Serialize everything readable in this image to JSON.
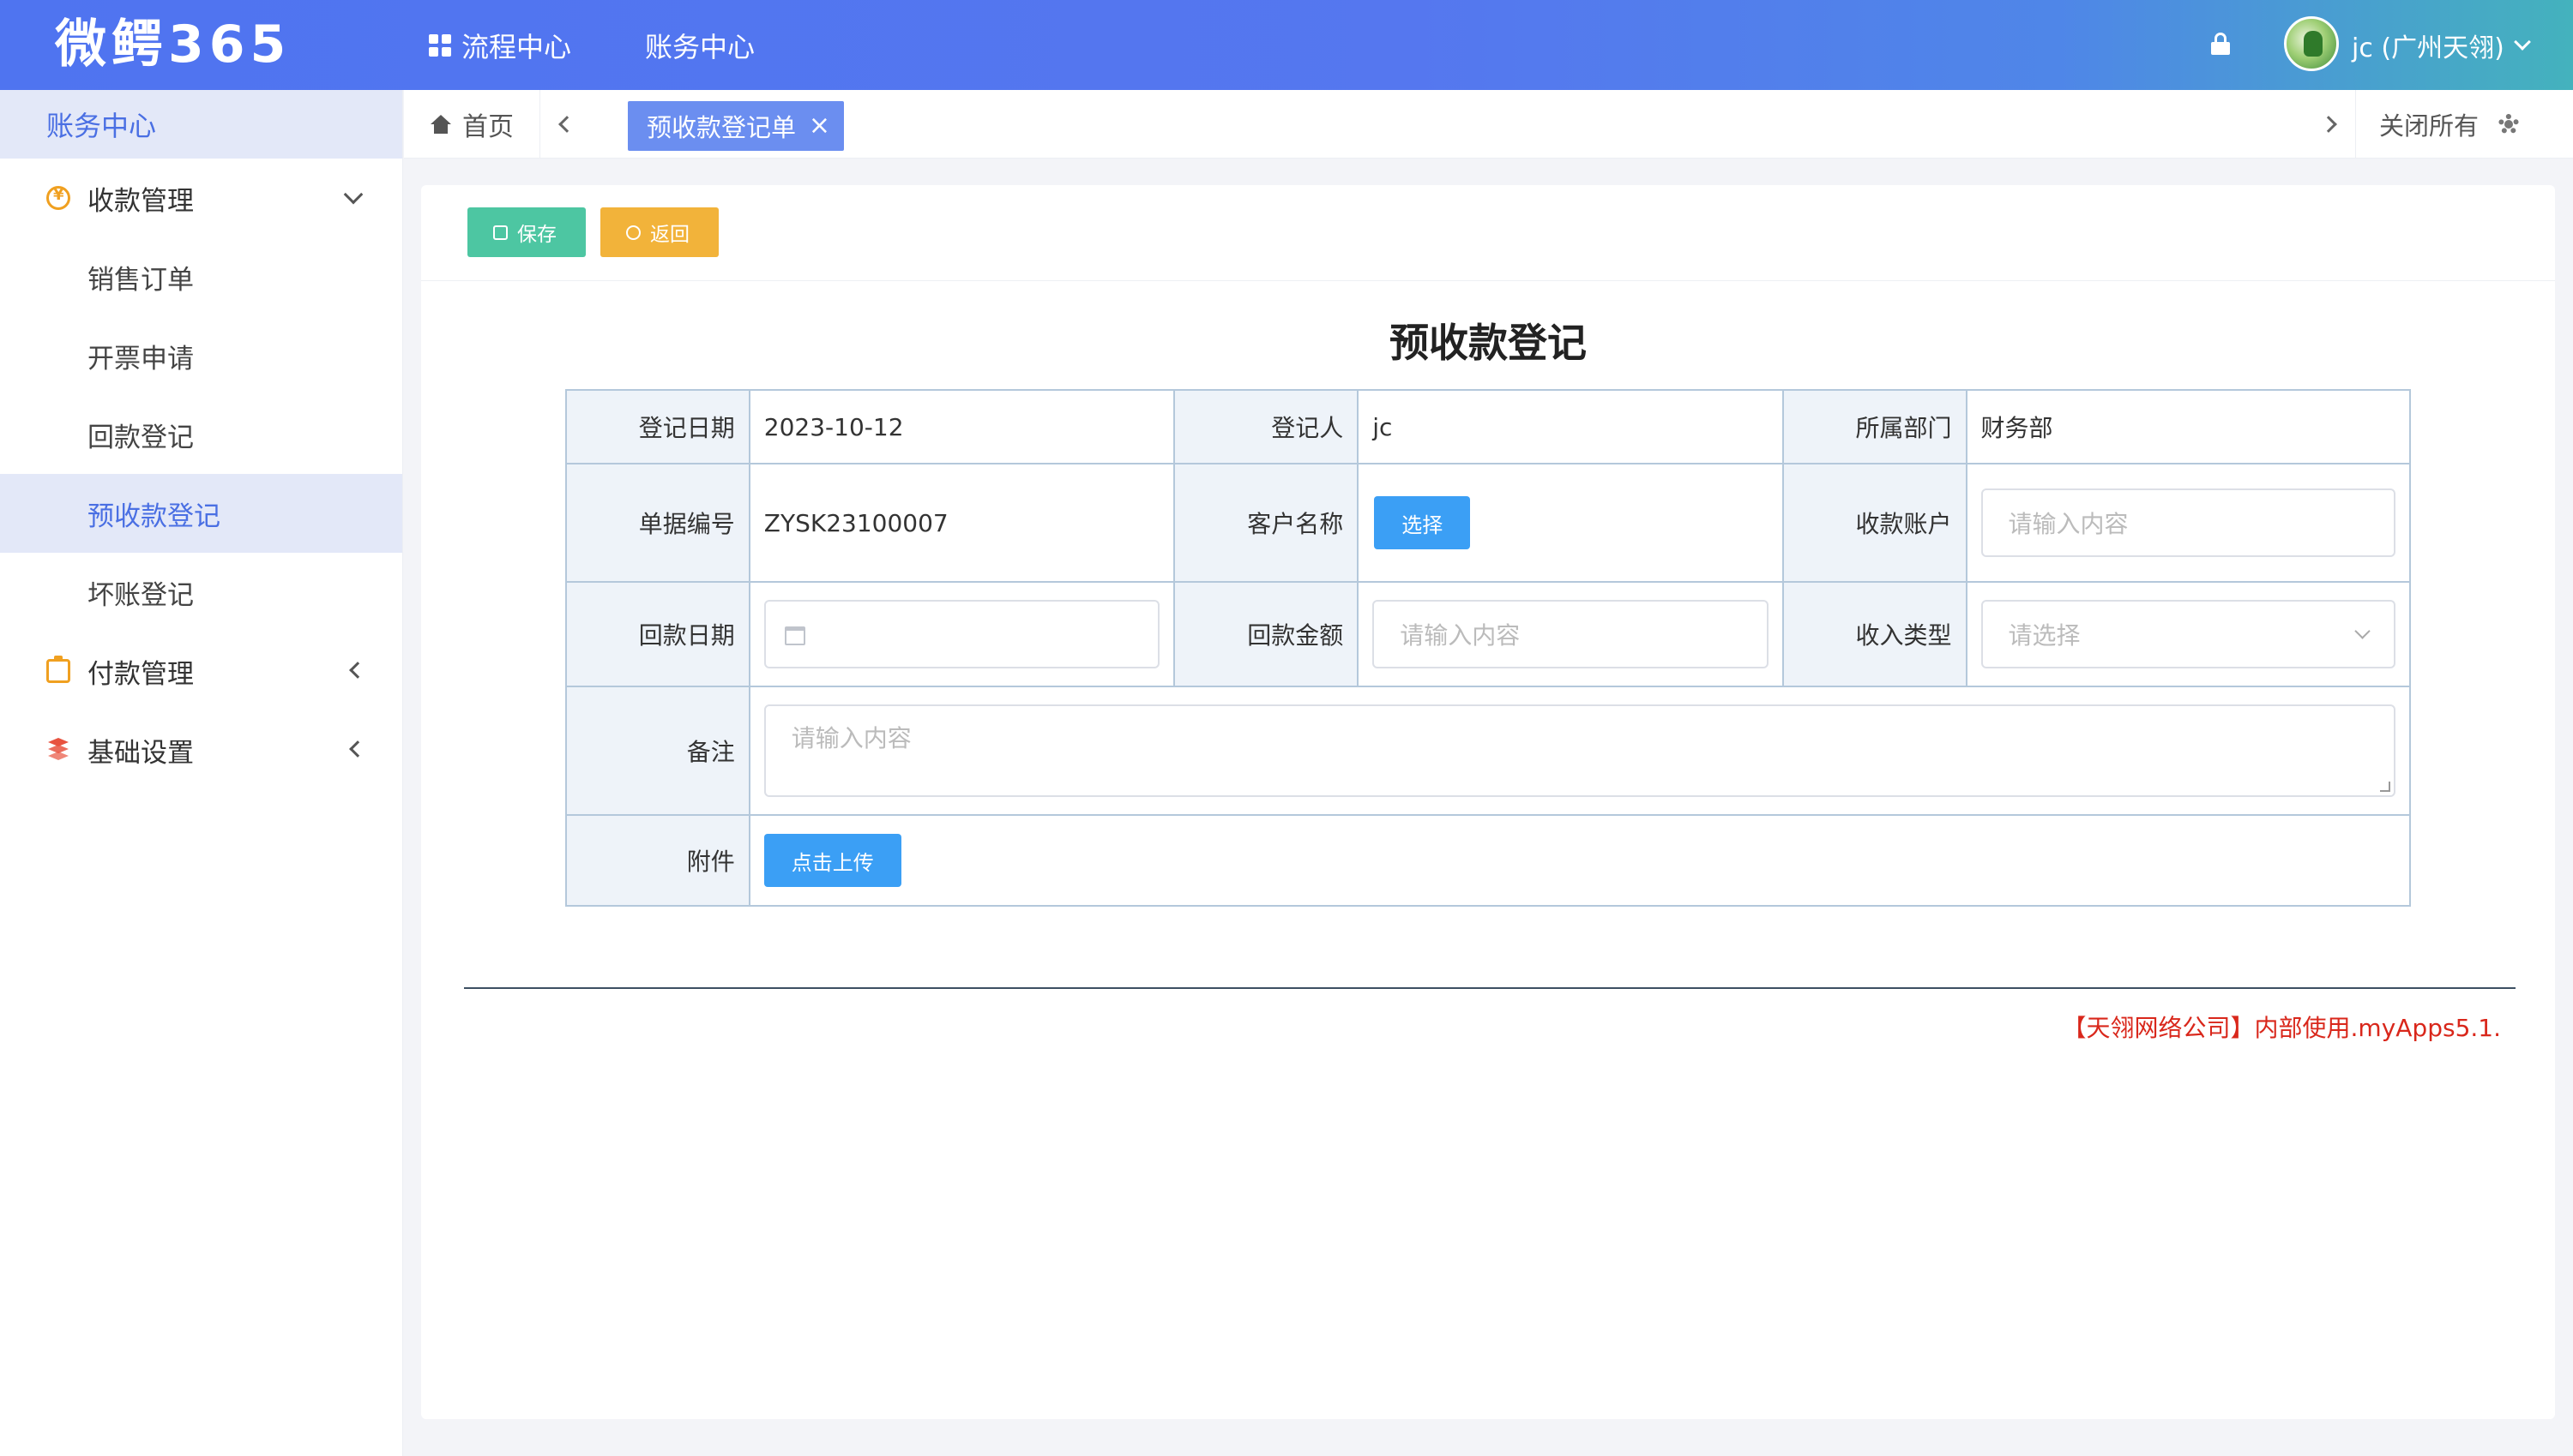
{
  "header": {
    "logo": "微鳄365",
    "nav": [
      {
        "label": "流程中心"
      },
      {
        "label": "账务中心"
      }
    ],
    "user": "jc (广州天翎)"
  },
  "sidebar": {
    "title": "账务中心",
    "groups": [
      {
        "label": "收款管理",
        "items": [
          {
            "label": "销售订单"
          },
          {
            "label": "开票申请"
          },
          {
            "label": "回款登记"
          },
          {
            "label": "预收款登记"
          },
          {
            "label": "坏账登记"
          }
        ]
      },
      {
        "label": "付款管理"
      },
      {
        "label": "基础设置"
      }
    ]
  },
  "tabs": {
    "home": "首页",
    "active": "预收款登记单",
    "close_all": "关闭所有"
  },
  "toolbar": {
    "save": "保存",
    "back": "返回"
  },
  "form": {
    "title": "预收款登记",
    "register_date_label": "登记日期",
    "register_date": "2023-10-12",
    "registrant_label": "登记人",
    "registrant": "jc",
    "dept_label": "所属部门",
    "dept": "财务部",
    "doc_no_label": "单据编号",
    "doc_no": "ZYSK23100007",
    "customer_label": "客户名称",
    "customer_button": "选择",
    "account_label": "收款账户",
    "account_placeholder": "请输入内容",
    "pay_date_label": "回款日期",
    "amount_label": "回款金额",
    "amount_placeholder": "请输入内容",
    "income_type_label": "收入类型",
    "income_type_placeholder": "请选择",
    "remark_label": "备注",
    "remark_placeholder": "请输入内容",
    "attachment_label": "附件",
    "upload_button": "点击上传"
  },
  "footer": {
    "note": "【天翎网络公司】内部使用.myApps5.1."
  }
}
